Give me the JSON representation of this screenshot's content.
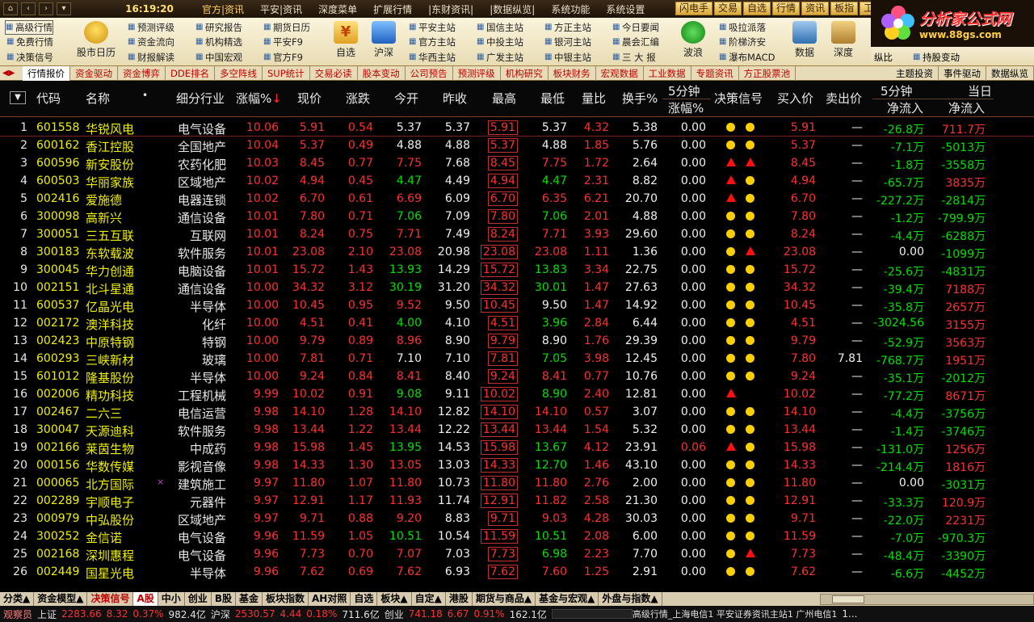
{
  "menubar": {
    "clock": "16:19:20",
    "menus": [
      "官方|资讯",
      "平安|资讯",
      "深度菜单",
      "扩展行情",
      "|东财资讯|",
      "|数据纵览|",
      "系统功能",
      "系统设置"
    ],
    "quick": [
      "闪电手",
      "交易",
      "自选",
      "行情",
      "资讯",
      "板指",
      "工具"
    ]
  },
  "logo": {
    "title": "分析家公式网",
    "url": "www.88gs.com"
  },
  "toolbar": {
    "col1": [
      "高级行情",
      "免费行情",
      "决策信号"
    ],
    "big1": "股市日历",
    "col2": [
      "预测评级",
      "资金流向",
      "财报解读"
    ],
    "col3": [
      "研究报告",
      "机构精选",
      "中国宏观"
    ],
    "col4": [
      "期货日历",
      "平安F9",
      "官方F9"
    ],
    "big2": "自选",
    "big3": "沪深",
    "col5": [
      "平安主站",
      "官方主站",
      "华西主站"
    ],
    "col6": [
      "国信主站",
      "中投主站",
      "广发主站"
    ],
    "col7": [
      "方正主站",
      "银河主站",
      "中银主站"
    ],
    "col8": [
      "今日要闻",
      "晨会汇编",
      "三 大 报"
    ],
    "big4": "波浪",
    "col9": [
      "吸拉派落",
      "阶梯济安",
      "瀑布MACD"
    ],
    "big5": "数据",
    "big6": "深度",
    "col10": [
      "纵比",
      "持股变动"
    ]
  },
  "tabs": [
    "行情报价",
    "资金驱动",
    "资金博弈",
    "DDE排名",
    "多空阵线",
    "SUP统计",
    "交易必读",
    "股本变动",
    "公司预告",
    "预测评级",
    "机构研究",
    "板块财务",
    "宏观数据",
    "工业数据",
    "专题资讯",
    "方正股票池"
  ],
  "tabs_right": [
    "主题投资",
    "事件驱动",
    "数据纵览"
  ],
  "headers": {
    "code": "代码",
    "name": "名称",
    "dot": "•",
    "industry": "细分行业",
    "change_pct": "涨幅%",
    "sort_arrow": "↓",
    "price": "现价",
    "change": "涨跌",
    "open": "今开",
    "prev_close": "昨收",
    "high": "最高",
    "low": "最低",
    "vol_ratio": "量比",
    "turnover": "换手%",
    "five_min_top": "5分钟",
    "five_min_bottom": "涨幅%",
    "signal": "决策信号",
    "bid": "买入价",
    "ask": "卖出价",
    "net5_top": "5分钟",
    "net5_bottom": "净流入",
    "netday_top": "当日",
    "netday_bottom": "净流入"
  },
  "rows": [
    {
      "i": "1",
      "code": "601558",
      "name": "华锐风电",
      "ind": "电气设备",
      "pct": "10.06",
      "price": "5.91",
      "chg": "0.54",
      "open": "5.37",
      "oc": "white",
      "prev": "5.37",
      "high": "5.91",
      "low": "5.37",
      "lc": "white",
      "vr": "4.32",
      "to": "5.38",
      "f5": "0.00",
      "f5c": "white",
      "s1": "dot",
      "s2": "dot",
      "bid": "5.91",
      "ask": "—",
      "n5": "-26.8万",
      "n5c": "green",
      "nd": "711.7万",
      "ndc": "red",
      "mark": ""
    },
    {
      "i": "2",
      "code": "600162",
      "name": "香江控股",
      "ind": "全国地产",
      "pct": "10.04",
      "price": "5.37",
      "chg": "0.49",
      "open": "4.88",
      "oc": "white",
      "prev": "4.88",
      "high": "5.37",
      "low": "4.88",
      "lc": "white",
      "vr": "1.85",
      "to": "5.76",
      "f5": "0.00",
      "f5c": "white",
      "s1": "dot",
      "s2": "dot",
      "bid": "5.37",
      "ask": "—",
      "n5": "-7.1万",
      "n5c": "green",
      "nd": "-5013万",
      "ndc": "green",
      "mark": ""
    },
    {
      "i": "3",
      "code": "600596",
      "name": "新安股份",
      "ind": "农药化肥",
      "pct": "10.03",
      "price": "8.45",
      "chg": "0.77",
      "open": "7.75",
      "oc": "red",
      "prev": "7.68",
      "high": "8.45",
      "low": "7.75",
      "lc": "red",
      "vr": "1.72",
      "to": "2.64",
      "f5": "0.00",
      "f5c": "white",
      "s1": "tri",
      "s2": "tri",
      "bid": "8.45",
      "ask": "—",
      "n5": "-1.8万",
      "n5c": "green",
      "nd": "-3558万",
      "ndc": "green",
      "mark": ""
    },
    {
      "i": "4",
      "code": "600503",
      "name": "华丽家族",
      "ind": "区域地产",
      "pct": "10.02",
      "price": "4.94",
      "chg": "0.45",
      "open": "4.47",
      "oc": "green",
      "prev": "4.49",
      "high": "4.94",
      "low": "4.47",
      "lc": "green",
      "vr": "2.31",
      "to": "8.82",
      "f5": "0.00",
      "f5c": "white",
      "s1": "tri",
      "s2": "dot",
      "bid": "4.94",
      "ask": "—",
      "n5": "-65.7万",
      "n5c": "green",
      "nd": "3835万",
      "ndc": "red",
      "mark": ""
    },
    {
      "i": "5",
      "code": "002416",
      "name": "爱施德",
      "ind": "电器连锁",
      "pct": "10.02",
      "price": "6.70",
      "chg": "0.61",
      "open": "6.69",
      "oc": "red",
      "prev": "6.09",
      "high": "6.70",
      "low": "6.35",
      "lc": "red",
      "vr": "6.21",
      "to": "20.70",
      "f5": "0.00",
      "f5c": "white",
      "s1": "tri",
      "s2": "dot",
      "bid": "6.70",
      "ask": "—",
      "n5": "-227.2万",
      "n5c": "green",
      "nd": "-2814万",
      "ndc": "green",
      "mark": ""
    },
    {
      "i": "6",
      "code": "300098",
      "name": "高新兴",
      "ind": "通信设备",
      "pct": "10.01",
      "price": "7.80",
      "chg": "0.71",
      "open": "7.06",
      "oc": "green",
      "prev": "7.09",
      "high": "7.80",
      "low": "7.06",
      "lc": "green",
      "vr": "2.01",
      "to": "4.88",
      "f5": "0.00",
      "f5c": "white",
      "s1": "dot",
      "s2": "dot",
      "bid": "7.80",
      "ask": "—",
      "n5": "-1.2万",
      "n5c": "green",
      "nd": "-799.9万",
      "ndc": "green",
      "mark": ""
    },
    {
      "i": "7",
      "code": "300051",
      "name": "三五互联",
      "ind": "互联网",
      "pct": "10.01",
      "price": "8.24",
      "chg": "0.75",
      "open": "7.71",
      "oc": "red",
      "prev": "7.49",
      "high": "8.24",
      "low": "7.71",
      "lc": "red",
      "vr": "3.93",
      "to": "29.60",
      "f5": "0.00",
      "f5c": "white",
      "s1": "dot",
      "s2": "dot",
      "bid": "8.24",
      "ask": "—",
      "n5": "-4.4万",
      "n5c": "green",
      "nd": "-6288万",
      "ndc": "green",
      "mark": ""
    },
    {
      "i": "8",
      "code": "300183",
      "name": "东软载波",
      "ind": "软件服务",
      "pct": "10.01",
      "price": "23.08",
      "chg": "2.10",
      "open": "23.08",
      "oc": "red",
      "prev": "20.98",
      "high": "23.08",
      "low": "23.08",
      "lc": "red",
      "vr": "1.11",
      "to": "1.36",
      "f5": "0.00",
      "f5c": "white",
      "s1": "dot",
      "s2": "tri",
      "bid": "23.08",
      "ask": "—",
      "n5": "0.00",
      "n5c": "white",
      "nd": "-1099万",
      "ndc": "green",
      "mark": ""
    },
    {
      "i": "9",
      "code": "300045",
      "name": "华力创通",
      "ind": "电脑设备",
      "pct": "10.01",
      "price": "15.72",
      "chg": "1.43",
      "open": "13.93",
      "oc": "green",
      "prev": "14.29",
      "high": "15.72",
      "low": "13.83",
      "lc": "green",
      "vr": "3.34",
      "to": "22.75",
      "f5": "0.00",
      "f5c": "white",
      "s1": "dot",
      "s2": "dot",
      "bid": "15.72",
      "ask": "—",
      "n5": "-25.6万",
      "n5c": "green",
      "nd": "-4831万",
      "ndc": "green",
      "mark": ""
    },
    {
      "i": "10",
      "code": "002151",
      "name": "北斗星通",
      "ind": "通信设备",
      "pct": "10.00",
      "price": "34.32",
      "chg": "3.12",
      "open": "30.19",
      "oc": "green",
      "prev": "31.20",
      "high": "34.32",
      "low": "30.01",
      "lc": "green",
      "vr": "1.47",
      "to": "27.63",
      "f5": "0.00",
      "f5c": "white",
      "s1": "dot",
      "s2": "dot",
      "bid": "34.32",
      "ask": "—",
      "n5": "-39.4万",
      "n5c": "green",
      "nd": "7188万",
      "ndc": "red",
      "mark": ""
    },
    {
      "i": "11",
      "code": "600537",
      "name": "亿晶光电",
      "ind": "半导体",
      "pct": "10.00",
      "price": "10.45",
      "chg": "0.95",
      "open": "9.52",
      "oc": "red",
      "prev": "9.50",
      "high": "10.45",
      "low": "9.50",
      "lc": "white",
      "vr": "1.47",
      "to": "14.92",
      "f5": "0.00",
      "f5c": "white",
      "s1": "dot",
      "s2": "dot",
      "bid": "10.45",
      "ask": "—",
      "n5": "-35.8万",
      "n5c": "green",
      "nd": "2657万",
      "ndc": "red",
      "mark": ""
    },
    {
      "i": "12",
      "code": "002172",
      "name": "澳洋科技",
      "ind": "化纤",
      "pct": "10.00",
      "price": "4.51",
      "chg": "0.41",
      "open": "4.00",
      "oc": "green",
      "prev": "4.10",
      "high": "4.51",
      "low": "3.96",
      "lc": "green",
      "vr": "2.84",
      "to": "6.44",
      "f5": "0.00",
      "f5c": "white",
      "s1": "dot",
      "s2": "dot",
      "bid": "4.51",
      "ask": "—",
      "n5": "-3024.56",
      "n5c": "green",
      "nd": "3155万",
      "ndc": "red",
      "mark": ""
    },
    {
      "i": "13",
      "code": "002423",
      "name": "中原特钢",
      "ind": "特钢",
      "pct": "10.00",
      "price": "9.79",
      "chg": "0.89",
      "open": "8.96",
      "oc": "red",
      "prev": "8.90",
      "high": "9.79",
      "low": "8.90",
      "lc": "white",
      "vr": "1.76",
      "to": "29.39",
      "f5": "0.00",
      "f5c": "white",
      "s1": "dot",
      "s2": "dot",
      "bid": "9.79",
      "ask": "—",
      "n5": "-52.9万",
      "n5c": "green",
      "nd": "3563万",
      "ndc": "red",
      "mark": ""
    },
    {
      "i": "14",
      "code": "600293",
      "name": "三峡新材",
      "ind": "玻璃",
      "pct": "10.00",
      "price": "7.81",
      "chg": "0.71",
      "open": "7.10",
      "oc": "white",
      "prev": "7.10",
      "high": "7.81",
      "low": "7.05",
      "lc": "green",
      "vr": "3.98",
      "to": "12.45",
      "f5": "0.00",
      "f5c": "white",
      "s1": "dot",
      "s2": "dot",
      "bid": "7.80",
      "ask": "7.81",
      "n5": "-768.7万",
      "n5c": "green",
      "nd": "1951万",
      "ndc": "red",
      "mark": ""
    },
    {
      "i": "15",
      "code": "601012",
      "name": "隆基股份",
      "ind": "半导体",
      "pct": "10.00",
      "price": "9.24",
      "chg": "0.84",
      "open": "8.41",
      "oc": "red",
      "prev": "8.40",
      "high": "9.24",
      "low": "8.41",
      "lc": "red",
      "vr": "0.77",
      "to": "10.76",
      "f5": "0.00",
      "f5c": "white",
      "s1": "dot",
      "s2": "dot",
      "bid": "9.24",
      "ask": "—",
      "n5": "-35.1万",
      "n5c": "green",
      "nd": "-2012万",
      "ndc": "green",
      "mark": ""
    },
    {
      "i": "16",
      "code": "002006",
      "name": "精功科技",
      "ind": "工程机械",
      "pct": "9.99",
      "price": "10.02",
      "chg": "0.91",
      "open": "9.08",
      "oc": "green",
      "prev": "9.11",
      "high": "10.02",
      "low": "8.90",
      "lc": "green",
      "vr": "2.40",
      "to": "12.81",
      "f5": "0.00",
      "f5c": "white",
      "s1": "tri",
      "s2": "",
      "bid": "10.02",
      "ask": "—",
      "n5": "-77.2万",
      "n5c": "green",
      "nd": "8671万",
      "ndc": "red",
      "mark": ""
    },
    {
      "i": "17",
      "code": "002467",
      "name": "二六三",
      "ind": "电信运营",
      "pct": "9.98",
      "price": "14.10",
      "chg": "1.28",
      "open": "14.10",
      "oc": "red",
      "prev": "12.82",
      "high": "14.10",
      "low": "14.10",
      "lc": "red",
      "vr": "0.57",
      "to": "3.07",
      "f5": "0.00",
      "f5c": "white",
      "s1": "dot",
      "s2": "dot",
      "bid": "14.10",
      "ask": "—",
      "n5": "-4.4万",
      "n5c": "green",
      "nd": "-3756万",
      "ndc": "green",
      "mark": ""
    },
    {
      "i": "18",
      "code": "300047",
      "name": "天源迪科",
      "ind": "软件服务",
      "pct": "9.98",
      "price": "13.44",
      "chg": "1.22",
      "open": "13.44",
      "oc": "red",
      "prev": "12.22",
      "high": "13.44",
      "low": "13.44",
      "lc": "red",
      "vr": "1.54",
      "to": "5.32",
      "f5": "0.00",
      "f5c": "white",
      "s1": "dot",
      "s2": "dot",
      "bid": "13.44",
      "ask": "—",
      "n5": "-1.4万",
      "n5c": "green",
      "nd": "-3746万",
      "ndc": "green",
      "mark": ""
    },
    {
      "i": "19",
      "code": "002166",
      "name": "莱茵生物",
      "ind": "中成药",
      "pct": "9.98",
      "price": "15.98",
      "chg": "1.45",
      "open": "13.95",
      "oc": "green",
      "prev": "14.53",
      "high": "15.98",
      "low": "13.67",
      "lc": "green",
      "vr": "4.12",
      "to": "23.91",
      "f5": "0.06",
      "f5c": "red",
      "s1": "tri",
      "s2": "dot",
      "bid": "15.98",
      "ask": "—",
      "n5": "-131.0万",
      "n5c": "green",
      "nd": "1256万",
      "ndc": "red",
      "mark": ""
    },
    {
      "i": "20",
      "code": "000156",
      "name": "华数传媒",
      "ind": "影视音像",
      "pct": "9.98",
      "price": "14.33",
      "chg": "1.30",
      "open": "13.05",
      "oc": "red",
      "prev": "13.03",
      "high": "14.33",
      "low": "12.70",
      "lc": "green",
      "vr": "1.46",
      "to": "43.10",
      "f5": "0.00",
      "f5c": "white",
      "s1": "dot",
      "s2": "dot",
      "bid": "14.33",
      "ask": "—",
      "n5": "-214.4万",
      "n5c": "green",
      "nd": "1816万",
      "ndc": "red",
      "mark": ""
    },
    {
      "i": "21",
      "code": "000065",
      "name": "北方国际",
      "ind": "建筑施工",
      "pct": "9.97",
      "price": "11.80",
      "chg": "1.07",
      "open": "11.80",
      "oc": "red",
      "prev": "10.73",
      "high": "11.80",
      "low": "11.80",
      "lc": "red",
      "vr": "2.76",
      "to": "2.00",
      "f5": "0.00",
      "f5c": "white",
      "s1": "dot",
      "s2": "dot",
      "bid": "11.80",
      "ask": "—",
      "n5": "0.00",
      "n5c": "white",
      "nd": "-3031万",
      "ndc": "green",
      "mark": "×"
    },
    {
      "i": "22",
      "code": "002289",
      "name": "宇顺电子",
      "ind": "元器件",
      "pct": "9.97",
      "price": "12.91",
      "chg": "1.17",
      "open": "11.93",
      "oc": "red",
      "prev": "11.74",
      "high": "12.91",
      "low": "11.82",
      "lc": "red",
      "vr": "2.58",
      "to": "21.30",
      "f5": "0.00",
      "f5c": "white",
      "s1": "dot",
      "s2": "dot",
      "bid": "12.91",
      "ask": "—",
      "n5": "-33.3万",
      "n5c": "green",
      "nd": "120.9万",
      "ndc": "red",
      "mark": ""
    },
    {
      "i": "23",
      "code": "000979",
      "name": "中弘股份",
      "ind": "区域地产",
      "pct": "9.97",
      "price": "9.71",
      "chg": "0.88",
      "open": "9.20",
      "oc": "red",
      "prev": "8.83",
      "high": "9.71",
      "low": "9.03",
      "lc": "red",
      "vr": "4.28",
      "to": "30.03",
      "f5": "0.00",
      "f5c": "white",
      "s1": "dot",
      "s2": "dot",
      "bid": "9.71",
      "ask": "—",
      "n5": "-22.0万",
      "n5c": "green",
      "nd": "2231万",
      "ndc": "red",
      "mark": ""
    },
    {
      "i": "24",
      "code": "300252",
      "name": "金信诺",
      "ind": "电气设备",
      "pct": "9.96",
      "price": "11.59",
      "chg": "1.05",
      "open": "10.51",
      "oc": "green",
      "prev": "10.54",
      "high": "11.59",
      "low": "10.51",
      "lc": "green",
      "vr": "2.08",
      "to": "6.00",
      "f5": "0.00",
      "f5c": "white",
      "s1": "dot",
      "s2": "dot",
      "bid": "11.59",
      "ask": "—",
      "n5": "-7.0万",
      "n5c": "green",
      "nd": "-970.3万",
      "ndc": "green",
      "mark": ""
    },
    {
      "i": "25",
      "code": "002168",
      "name": "深圳惠程",
      "ind": "电气设备",
      "pct": "9.96",
      "price": "7.73",
      "chg": "0.70",
      "open": "7.07",
      "oc": "red",
      "prev": "7.03",
      "high": "7.73",
      "low": "6.98",
      "lc": "green",
      "vr": "2.23",
      "to": "7.70",
      "f5": "0.00",
      "f5c": "white",
      "s1": "dot",
      "s2": "tri",
      "bid": "7.73",
      "ask": "—",
      "n5": "-48.4万",
      "n5c": "green",
      "nd": "-3390万",
      "ndc": "green",
      "mark": ""
    },
    {
      "i": "26",
      "code": "002449",
      "name": "国星光电",
      "ind": "半导体",
      "pct": "9.96",
      "price": "7.62",
      "chg": "0.69",
      "open": "7.62",
      "oc": "red",
      "prev": "6.93",
      "high": "7.62",
      "low": "7.60",
      "lc": "red",
      "vr": "1.25",
      "to": "2.91",
      "f5": "0.00",
      "f5c": "white",
      "s1": "dot",
      "s2": "dot",
      "bid": "7.62",
      "ask": "—",
      "n5": "-6.6万",
      "n5c": "green",
      "nd": "-4452万",
      "ndc": "green",
      "mark": ""
    }
  ],
  "bottom_tabs": [
    "分类▲",
    "资金模型▲",
    "决策信号",
    "A股",
    "中小",
    "创业",
    "B股",
    "基金",
    "板块指数",
    "AH对照",
    "自选",
    "板块▲",
    "自定▲",
    "港股",
    "期货与商品▲",
    "基金与宏观▲",
    "外盘与指数▲"
  ],
  "status": {
    "label": "观察员",
    "sh_name": "上证",
    "sh_val": "2283.66",
    "sh_chg": "8.32",
    "sh_pct": "0.37%",
    "sh_amt": "982.4亿",
    "sz_name": "沪深",
    "sz_val": "2530.57",
    "sz_chg": "4.44",
    "sz_pct": "0.18%",
    "sz_amt": "711.6亿",
    "cy_name": "创业",
    "cy_val": "741.18",
    "cy_chg": "6.67",
    "cy_pct": "0.91%",
    "cy_amt": "162.1亿",
    "server": "高级行情_上海电信1 平安证券资讯主站1 广州电信1",
    "page": "1..."
  }
}
